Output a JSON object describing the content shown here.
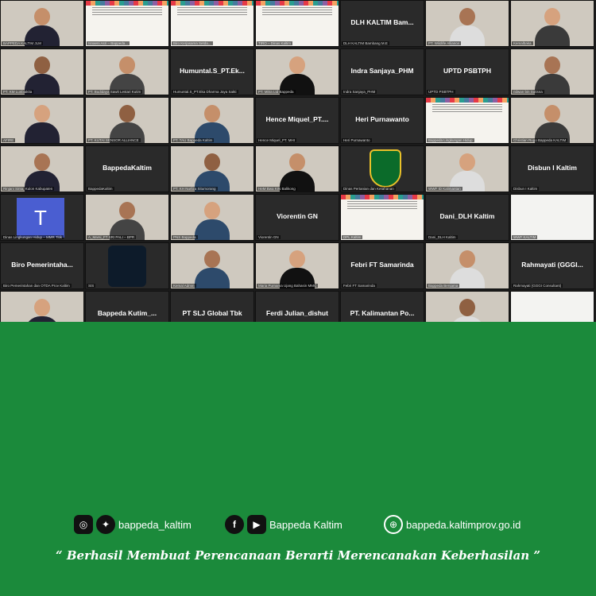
{
  "participants": [
    {
      "name": "",
      "caption": "BAPPEDA KALTIM JLM",
      "style": "cam"
    },
    {
      "name": "",
      "caption": "Isnaeni Asri – Bappeda...",
      "style": "banner"
    },
    {
      "name": "",
      "caption": "Biro Kerjasama Setda...",
      "style": "banner"
    },
    {
      "name": "",
      "caption": "TIRO – Dinas Kaltim",
      "style": "banner"
    },
    {
      "name": "DLH KALTIM Bam...",
      "caption": "DLH KALTIM Bambang M.E",
      "style": "dark"
    },
    {
      "name": "",
      "caption": "PT. Wildlife Alliance",
      "style": "cam"
    },
    {
      "name": "",
      "caption": "Kemalbaka",
      "style": "cam"
    },
    {
      "name": "",
      "caption": "PT. KM Lunbiakita",
      "style": "cam"
    },
    {
      "name": "",
      "caption": "PT. Budidaya Sawit Lestari Kutim",
      "style": "cam"
    },
    {
      "name": "Humuntal.S_PT.Ek...",
      "caption": "Humuntal.S_PT.Eka Dharma Jaya Sakti",
      "style": "dark"
    },
    {
      "name": "",
      "caption": "PT. Mitra Ltd Bappeda",
      "style": "cam"
    },
    {
      "name": "Indra Sanjaya_PHM",
      "caption": "Indra Sanjaya_PHM",
      "style": "dark"
    },
    {
      "name": "UPTD PSBTPH",
      "caption": "UPTD PSBTPH",
      "style": "dark"
    },
    {
      "name": "",
      "caption": "ridwan bin Sutisna",
      "style": "cam"
    },
    {
      "name": "",
      "caption": "AFIRE",
      "style": "cam"
    },
    {
      "name": "",
      "caption": "PT. KUTAI SENSOR ALLIANCE",
      "style": "cam"
    },
    {
      "name": "",
      "caption": "PT. TAU Bappeda Kaltim",
      "style": "cam"
    },
    {
      "name": "Hence Miquel_PT....",
      "caption": "Hence Miquel_PT. MHI",
      "style": "dark"
    },
    {
      "name": "Heri Purnawanto",
      "caption": "Heri Purnawanto",
      "style": "dark"
    },
    {
      "name": "",
      "caption": "Bappeda Lingkungan Hidup",
      "style": "banner"
    },
    {
      "name": "",
      "caption": "Christian Rugo Bappeda KALTIM",
      "style": "cam"
    },
    {
      "name": "",
      "caption": "Rinjani Sinta, Kulon Kabupaten",
      "style": "cam"
    },
    {
      "name": "BappedaKaltim",
      "caption": "BappedaKaltim",
      "style": "dark"
    },
    {
      "name": "",
      "caption": "PT. KH Nurliza Situmorang",
      "style": "cam"
    },
    {
      "name": "",
      "caption": "HeM Bwa KIN Balikong",
      "style": "cam"
    },
    {
      "name": "",
      "caption": "Dinas Pertanian dan Ketahanan",
      "style": "dark"
    },
    {
      "name": "",
      "caption": "WWF ID Kalimantan",
      "style": "cam"
    },
    {
      "name": "Disbun I Kaltim",
      "caption": "Disbun I Kaltim",
      "style": "dark"
    },
    {
      "name": "",
      "caption": "Dinas Lingkungan Hidup – MMR Titik",
      "style": "dark"
    },
    {
      "name": "",
      "caption": "A_Marsi_FT SRI PALI – BPR",
      "style": "cam"
    },
    {
      "name": "",
      "caption": "PNS Bappeda",
      "style": "cam"
    },
    {
      "name": "Viorentin GN",
      "caption": "Viorentin GN",
      "style": "dark"
    },
    {
      "name": "",
      "caption": "DPL Kaltim",
      "style": "banner"
    },
    {
      "name": "Dani_DLH Kaltim",
      "caption": "Dani_DLH Kaltim",
      "style": "dark"
    },
    {
      "name": "",
      "caption": "WWF KALTIM",
      "style": "white"
    },
    {
      "name": "Biro Pemerintaha...",
      "caption": "Biro Pemerintahan dan OTDA Prov Kaltim",
      "style": "dark"
    },
    {
      "name": "",
      "caption": "SIS",
      "style": "dark"
    },
    {
      "name": "",
      "caption": "Kemal Admin",
      "style": "cam"
    },
    {
      "name": "",
      "caption": "Maria Purnama Ujang Bahasin MMC",
      "style": "cam"
    },
    {
      "name": "Febri FT Samarinda",
      "caption": "Febri FT Samarinda",
      "style": "dark"
    },
    {
      "name": "",
      "caption": "Bappeda Bersama",
      "style": "cam"
    },
    {
      "name": "Rahmayati (GGGI...",
      "caption": "Rahmayati (GGGI Consultant)",
      "style": "dark"
    },
    {
      "name": "",
      "caption": "",
      "style": "cam"
    },
    {
      "name": "Bappeda Kutim_...",
      "caption": "",
      "style": "dark"
    },
    {
      "name": "PT SLJ Global Tbk",
      "caption": "",
      "style": "dark"
    },
    {
      "name": "Ferdi Julian_dishut",
      "caption": "",
      "style": "dark"
    },
    {
      "name": "PT. Kalimantan Po...",
      "caption": "",
      "style": "dark"
    },
    {
      "name": "",
      "caption": "",
      "style": "cam"
    },
    {
      "name": "",
      "caption": "",
      "style": "white"
    }
  ],
  "footer": {
    "instagram_handle": "bappeda_kaltim",
    "facebook_youtube": "Bappeda Kaltim",
    "website": "bappeda.kaltimprov.go.id",
    "tagline": "“ Berhasil  Membuat Perencanaan Berarti Merencanakan Keberhasilan ”",
    "colors": {
      "background": "#1b8a3b",
      "text": "#ffffff"
    },
    "icons": [
      "instagram-icon",
      "twitter-icon",
      "facebook-icon",
      "youtube-icon",
      "globe-icon"
    ]
  }
}
